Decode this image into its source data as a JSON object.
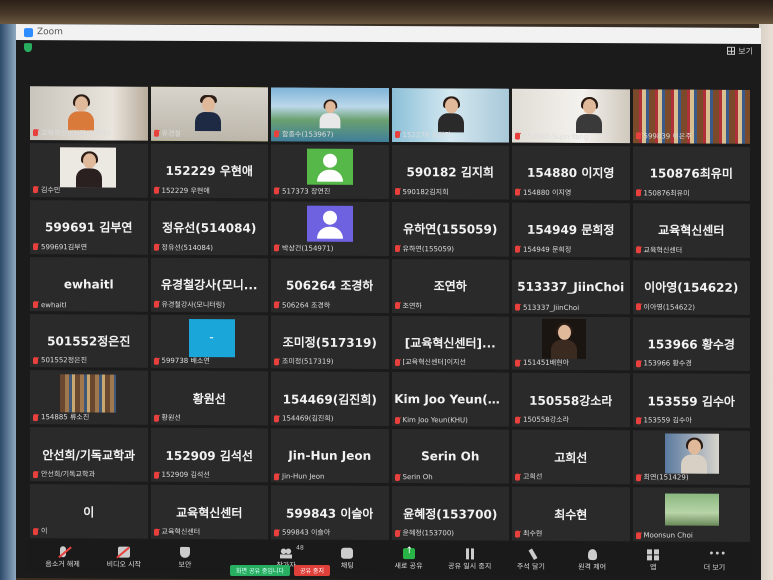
{
  "window": {
    "title": "Zoom",
    "view_label": "보기"
  },
  "tiles": [
    {
      "label": "교육혁신센터장(이혁주)",
      "big": "",
      "video": "woman-office"
    },
    {
      "label": "유경철",
      "big": "",
      "video": "man-suit",
      "active": true
    },
    {
      "label": "함종수(153967)",
      "big": "",
      "video": "landscape"
    },
    {
      "label": "152278 김현진",
      "big": "",
      "video": "woman-window"
    },
    {
      "label": "153680-Sujin Yang",
      "big": "",
      "video": "woman-room"
    },
    {
      "label": "599839 이은주",
      "big": "",
      "video": "bookshelf"
    },
    {
      "label": "김수민",
      "big": "",
      "video": "woman-photo"
    },
    {
      "label": "152229 우현애",
      "big": "152229 우현애"
    },
    {
      "label": "517373 장연진",
      "big": "",
      "video": "avatar-green"
    },
    {
      "label": "590182김지희",
      "big": "590182 김지희"
    },
    {
      "label": "154880 이지영",
      "big": "154880 이지영"
    },
    {
      "label": "150876최유미",
      "big": "150876최유미"
    },
    {
      "label": "599691김부연",
      "big": "599691 김부연"
    },
    {
      "label": "정유선(514084)",
      "big": "정유선(514084)"
    },
    {
      "label": "박상건(154971)",
      "big": "",
      "video": "avatar-purple"
    },
    {
      "label": "유하연(155059)",
      "big": "유하연(155059)"
    },
    {
      "label": "154949 문희정",
      "big": "154949 문희정"
    },
    {
      "label": "교육혁신센터",
      "big": "교육혁신센터"
    },
    {
      "label": "ewhaitl",
      "big": "ewhaitl"
    },
    {
      "label": "유경철강사(모니터링)",
      "big": "유경철강사(모니..."
    },
    {
      "label": "506264 조경하",
      "big": "506264 조경하"
    },
    {
      "label": "조연하",
      "big": "조연하"
    },
    {
      "label": "513337_JiinChoi",
      "big": "513337_JiinChoi"
    },
    {
      "label": "이아영(154622)",
      "big": "이아영(154622)"
    },
    {
      "label": "501552정은진",
      "big": "501552정은진"
    },
    {
      "label": "599738 배소연",
      "big": "",
      "video": "cyan-box"
    },
    {
      "label": "조미정(517319)",
      "big": "조미정(517319)"
    },
    {
      "label": "[교육혁신센터]이지선",
      "big": "[교육혁신센터]..."
    },
    {
      "label": "151451배현아",
      "big": "",
      "video": "woman-dark"
    },
    {
      "label": "153966 황수경",
      "big": "153966 황수경"
    },
    {
      "label": "154885 류소진",
      "big": "",
      "video": "library"
    },
    {
      "label": "황원선",
      "big": "황원선"
    },
    {
      "label": "154469(김진희)",
      "big": "154469(김진희)"
    },
    {
      "label": "Kim Joo Yeun(KHU)",
      "big": "Kim Joo Yeun(K..."
    },
    {
      "label": "150558강소라",
      "big": "150558강소라"
    },
    {
      "label": "153559 김수아",
      "big": "153559 김수아"
    },
    {
      "label": "안선희/기독교학과",
      "big": "안선희/기독교학과"
    },
    {
      "label": "152909 김석선",
      "big": "152909 김석선"
    },
    {
      "label": "Jin-Hun Jeon",
      "big": "Jin-Hun Jeon"
    },
    {
      "label": "Serin Oh",
      "big": "Serin Oh"
    },
    {
      "label": "고희선",
      "big": "고희선"
    },
    {
      "label": "최연(151429)",
      "big": "",
      "video": "woman-shelf"
    },
    {
      "label": "이",
      "big": "이"
    },
    {
      "label": "교육혁신센터",
      "big": "교육혁신센터"
    },
    {
      "label": "599843 이슬아",
      "big": "599843 이슬아"
    },
    {
      "label": "윤혜정(153700)",
      "big": "윤혜정(153700)"
    },
    {
      "label": "최수현",
      "big": "최수현"
    },
    {
      "label": "Moonsun Choi",
      "big": "",
      "video": "green-room"
    }
  ],
  "toolbar": {
    "mute": "음소거 해제",
    "video": "비디오 시작",
    "security": "보안",
    "participants": "참가자",
    "participants_count": "48",
    "chat": "채팅",
    "share": "새로 공유",
    "pause": "공유 일시 중지",
    "annotate": "주석 달기",
    "remote": "원격 제어",
    "apps": "앱",
    "more": "더 보기"
  },
  "sharebar": {
    "sharing": "화면 공유 중입니다",
    "stop": "공유 중지"
  },
  "colors": {
    "active_outline": "#c9d53a",
    "muted_red": "#e8403d",
    "share_green": "#27ae60"
  }
}
